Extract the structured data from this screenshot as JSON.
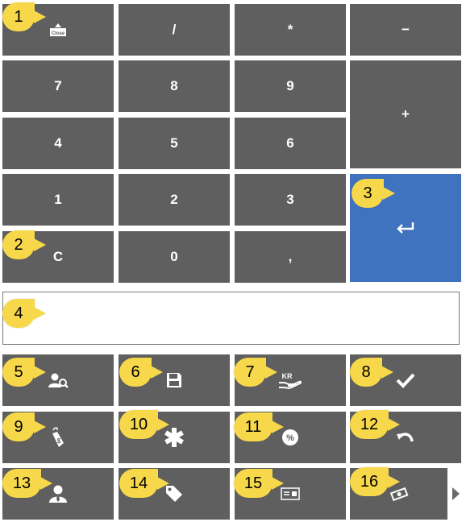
{
  "keypad": {
    "close_label": "Close",
    "divide": "/",
    "multiply": "*",
    "minus": "−",
    "plus": "+",
    "seven": "7",
    "eight": "8",
    "nine": "9",
    "four": "4",
    "five": "5",
    "six": "6",
    "one": "1",
    "two": "2",
    "three": "3",
    "clear": "C",
    "zero": "0",
    "comma": ",",
    "enter_icon": "enter-arrow-icon"
  },
  "display": {
    "value": ""
  },
  "function_buttons": [
    {
      "icon": "customer-search-icon"
    },
    {
      "icon": "save-icon"
    },
    {
      "icon": "kr-hand-payment-icon",
      "text": "KR"
    },
    {
      "icon": "checkmark-icon"
    },
    {
      "icon": "price-tag-icon",
      "text": "$"
    },
    {
      "icon": "asterisk-icon"
    },
    {
      "icon": "discount-percent-icon",
      "text": "%"
    },
    {
      "icon": "undo-icon"
    },
    {
      "icon": "customer-icon"
    },
    {
      "icon": "tag-icon"
    },
    {
      "icon": "card-icon"
    },
    {
      "icon": "cash-icon"
    }
  ],
  "callouts": [
    "1",
    "2",
    "3",
    "4",
    "5",
    "6",
    "7",
    "8",
    "9",
    "10",
    "11",
    "12",
    "13",
    "14",
    "15",
    "16"
  ],
  "colors": {
    "key_bg": "#5f5f5f",
    "enter_bg": "#3f73bf",
    "callout": "#f6d84a",
    "key_text": "#ffffff"
  }
}
